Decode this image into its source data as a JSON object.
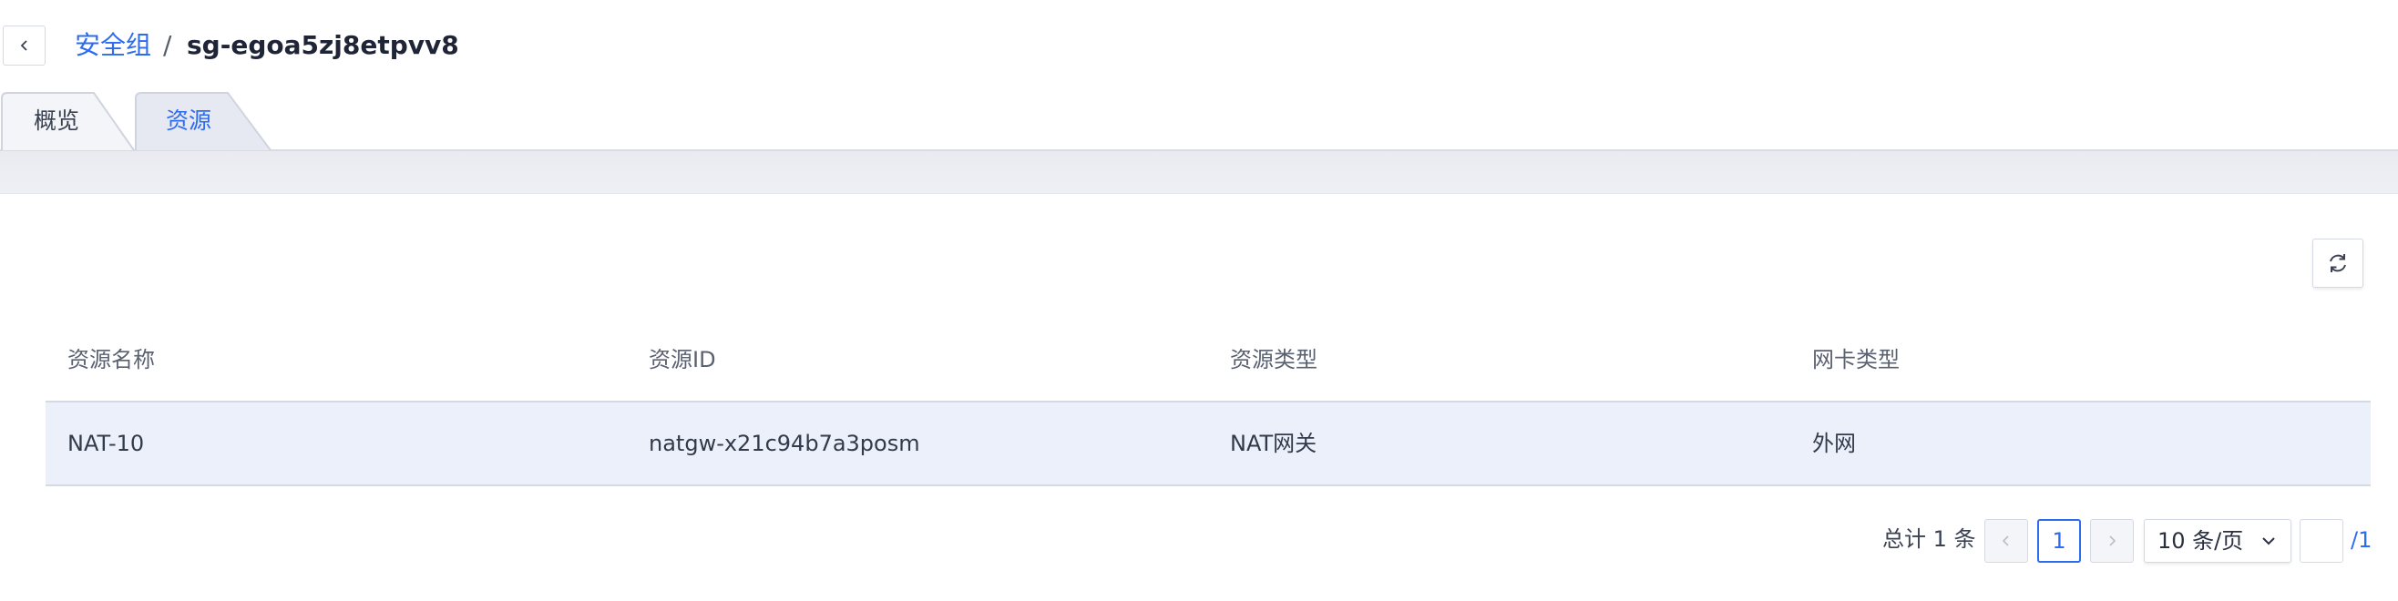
{
  "breadcrumb": {
    "parent": "安全组",
    "separator": "/",
    "current": "sg-egoa5zj8etpvv8"
  },
  "tabs": [
    {
      "label": "概览",
      "active": false
    },
    {
      "label": "资源",
      "active": true
    }
  ],
  "table": {
    "columns": [
      "资源名称",
      "资源ID",
      "资源类型",
      "网卡类型"
    ],
    "rows": [
      [
        "NAT-10",
        "natgw-x21c94b7a3posm",
        "NAT网关",
        "外网"
      ]
    ]
  },
  "pagination": {
    "total_text": "总计 1 条",
    "current_page": "1",
    "page_size": "10 条/页",
    "jump_value": "",
    "total_pages": "/1"
  },
  "icons": {
    "back": "chevron-left-icon",
    "refresh": "refresh-icon",
    "prev": "chevron-left-icon",
    "next": "chevron-right-icon",
    "dropdown": "chevron-down-icon"
  },
  "colors": {
    "accent": "#2d6bf0",
    "row_highlight": "#ebf0fa",
    "border": "#d5d9e3"
  }
}
